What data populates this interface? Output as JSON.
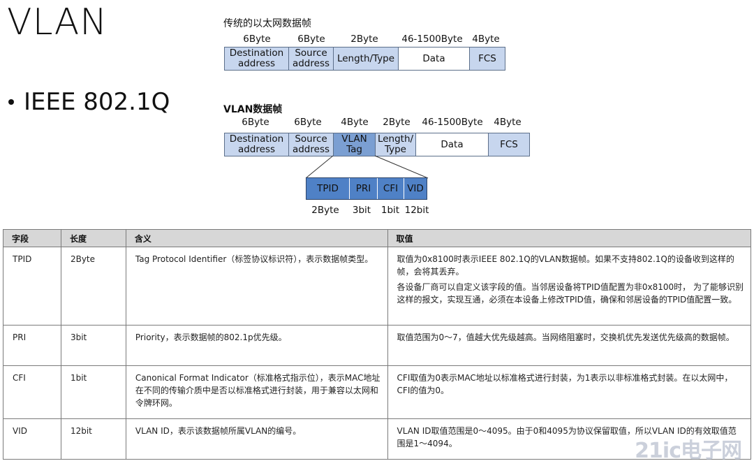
{
  "slide": {
    "title": "VLAN",
    "bullet": "IEEE 802.1Q"
  },
  "ethernet_frame": {
    "label": "传统的以太网数据帧",
    "sizes": [
      "6Byte",
      "6Byte",
      "2Byte",
      "46-1500Byte",
      "4Byte"
    ],
    "fields": [
      "Destination address",
      "Source address",
      "Length/Type",
      "Data",
      "FCS"
    ]
  },
  "vlan_frame": {
    "label": "VLAN数据帧",
    "sizes": [
      "6Byte",
      "6Byte",
      "4Byte",
      "2Byte",
      "46-1500Byte",
      "4Byte"
    ],
    "fields": [
      "Destination address",
      "Source address",
      "VLAN Tag",
      "Length/ Type",
      "Data",
      "FCS"
    ]
  },
  "vlan_tag": {
    "fields": [
      "TPID",
      "PRI",
      "CFI",
      "VID"
    ],
    "sizes": [
      "2Byte",
      "3bit",
      "1bit",
      "12bit"
    ]
  },
  "table": {
    "headers": [
      "字段",
      "长度",
      "含义",
      "取值"
    ],
    "rows": [
      {
        "field": "TPID",
        "length": "2Byte",
        "meaning": "Tag Protocol Identifier（标签协议标识符），表示数据帧类型。",
        "value_1": "取值为0x8100时表示IEEE 802.1Q的VLAN数据帧。如果不支持802.1Q的设备收到这样的帧，会将其丢弃。",
        "value_2": "各设备厂商可以自定义该字段的值。当邻居设备将TPID值配置为非0x8100时， 为了能够识别这样的报文，实现互通，必须在本设备上修改TPID值，确保和邻居设备的TPID值配置一致。"
      },
      {
        "field": "PRI",
        "length": "3bit",
        "meaning": "Priority，表示数据帧的802.1p优先级。",
        "value_1": "取值范围为0～7，值越大优先级越高。当网络阻塞时，交换机优先发送优先级高的数据帧。"
      },
      {
        "field": "CFI",
        "length": "1bit",
        "meaning": "Canonical Format Indicator（标准格式指示位），表示MAC地址在不同的传输介质中是否以标准格式进行封装，用于兼容以太网和令牌环网。",
        "value_1": "CFI取值为0表示MAC地址以标准格式进行封装，为1表示以非标准格式封装。在以太网中，CFI的值为0。"
      },
      {
        "field": "VID",
        "length": "12bit",
        "meaning": "VLAN ID，表示该数据帧所属VLAN的编号。",
        "value_1": "VLAN ID取值范围是0～4095。由于0和4095为协议保留取值，所以VLAN ID的有效取值范围是1～4094。"
      }
    ]
  },
  "watermark": "21ic电子网"
}
